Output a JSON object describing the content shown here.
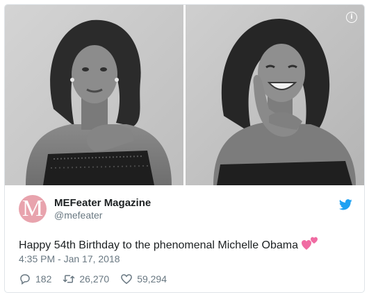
{
  "media": {
    "info_icon": "info-icon"
  },
  "author": {
    "avatar_letter": "M",
    "name": "MEFeater Magazine",
    "handle": "@mefeater",
    "platform_icon": "twitter-bird-icon"
  },
  "tweet": {
    "text": "Happy 54th Birthday to the phenomenal Michelle Obama",
    "emoji_icon": "two-hearts-icon",
    "timestamp": "4:35 PM - Jan 17, 2018"
  },
  "actions": {
    "replies": "182",
    "retweets": "26,270",
    "likes": "59,294"
  },
  "colors": {
    "twitter_blue": "#1da1f2",
    "avatar_pink": "#e8a3ad",
    "heart_pink": "#f06ba2",
    "meta_gray": "#697882"
  }
}
